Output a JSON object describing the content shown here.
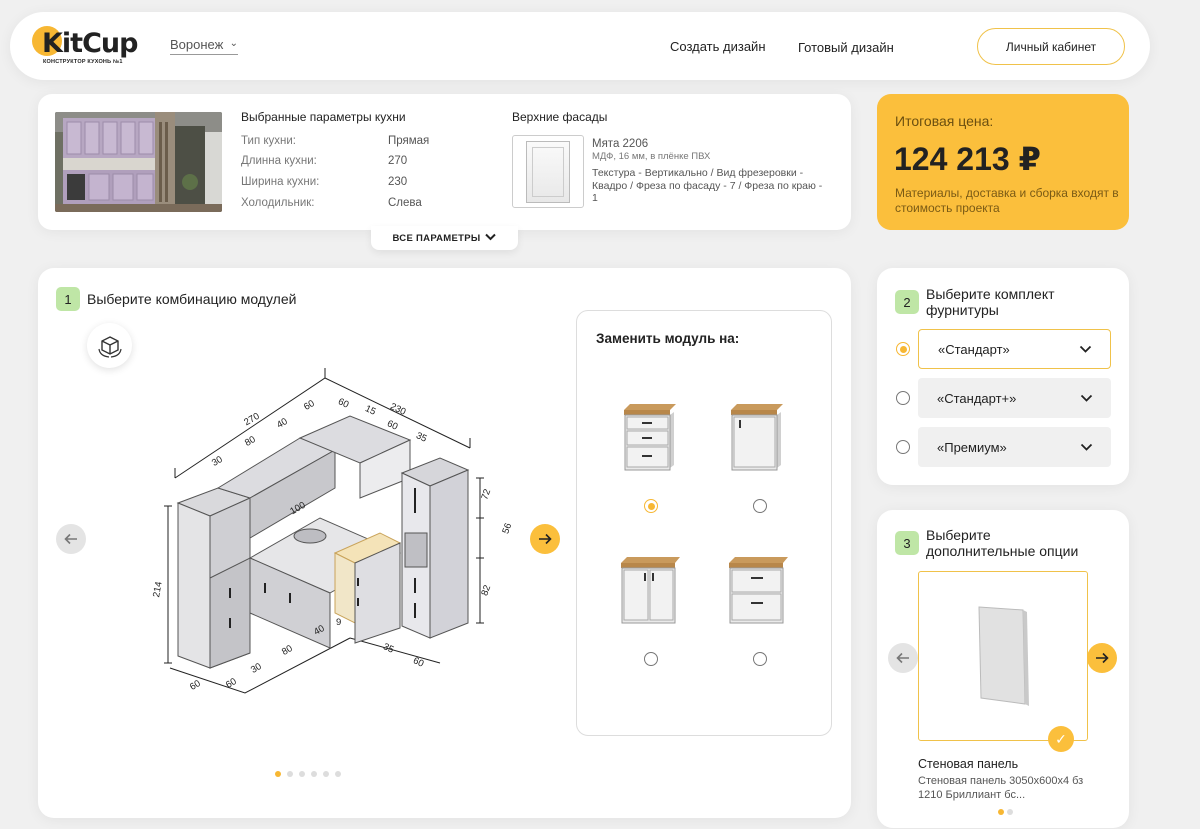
{
  "header": {
    "logo": "KitCup",
    "logo_sub": "КОНСТРУКТОР КУХОНЬ №1",
    "city": "Воронеж",
    "nav": [
      "Создать дизайн",
      "Готовый дизайн"
    ],
    "cabinet": "Личный кабинет"
  },
  "params": {
    "title": "Выбранные параметры кухни",
    "rows": [
      {
        "label": "Тип кухни:",
        "value": "Прямая"
      },
      {
        "label": "Длинна кухни:",
        "value": "270"
      },
      {
        "label": "Ширина кухни:",
        "value": "230"
      },
      {
        "label": "Холодильник:",
        "value": "Слева"
      }
    ],
    "facade_title": "Верхние фасады",
    "facade_name": "Мята 2206",
    "facade_material": "МДФ, 16 мм, в плёнке ПВХ",
    "facade_desc": "Текстура - Вертикально / Вид фрезеровки - Квадро / Фреза по фасаду - 7 / Фреза по краю - 1",
    "all_params": "ВСЕ ПАРАМЕТРЫ"
  },
  "price": {
    "label": "Итоговая цена:",
    "value": "124 213 ₽",
    "note": "Материалы, доставка и сборка входят в стоимость проекта"
  },
  "step1": {
    "num": "1",
    "title": "Выберите комбинацию модулей",
    "replace_title": "Заменить модуль на:",
    "selected_module": 0,
    "dots": 6,
    "active_dot": 0,
    "dims": {
      "top": [
        "270",
        "80",
        "40",
        "60",
        "60",
        "15",
        "230",
        "60",
        "35",
        "30"
      ],
      "right": [
        "72",
        "56",
        "82"
      ],
      "left": "214",
      "mid": "100",
      "bottom": [
        "60",
        "60",
        "30",
        "80",
        "40",
        "9",
        "35",
        "60"
      ]
    }
  },
  "step2": {
    "num": "2",
    "title_l1": "Выберите комплект",
    "title_l2": "фурнитуры",
    "options": [
      "«Стандарт»",
      "«Стандарт+»",
      "«Премиум»"
    ],
    "selected": 0
  },
  "step3": {
    "num": "3",
    "title_l1": "Выберите",
    "title_l2": "дополнительные опции",
    "item_name": "Стеновая панель",
    "item_desc": "Стеновая панель 3050х600х4 бз 1210 Бриллиант бс...",
    "dots": 2,
    "active_dot": 0
  },
  "colors": {
    "accent": "#fbbf3c",
    "step_badge": "#bfe6a6",
    "text": "#222222"
  }
}
